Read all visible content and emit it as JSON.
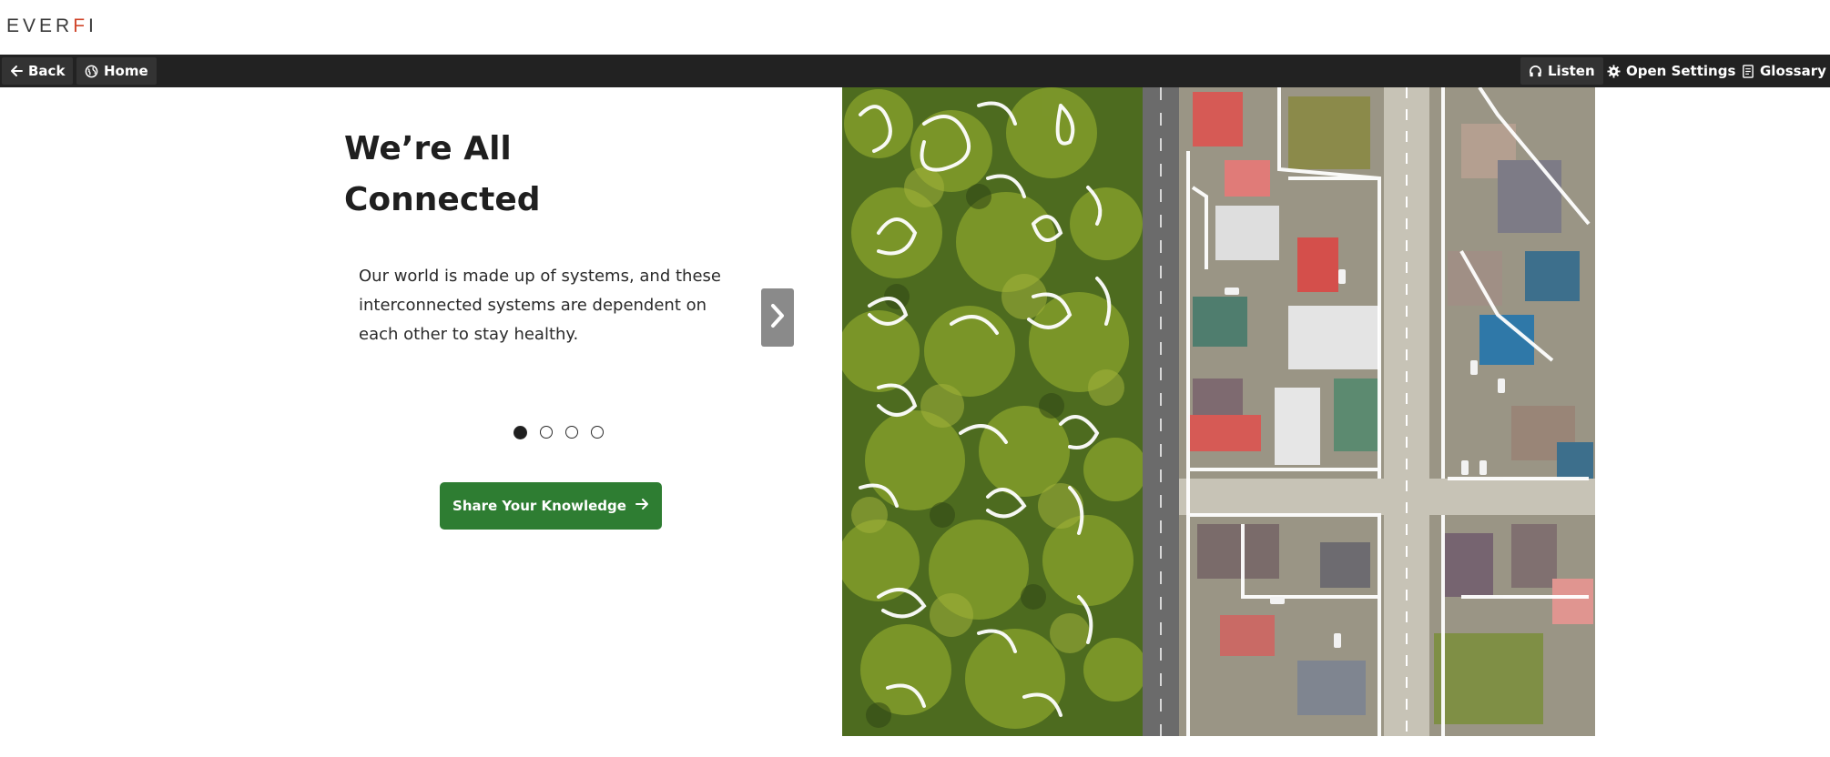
{
  "brand": {
    "logo_text_a": "EVER",
    "logo_text_b": "F",
    "logo_text_c": "I"
  },
  "toolbar": {
    "back_label": "Back",
    "home_label": "Home",
    "listen_label": "Listen",
    "settings_label": "Open Settings",
    "glossary_label": "Glossary"
  },
  "slide": {
    "title_line1": "We’re All",
    "title_line2": "Connected",
    "body_line1": "Our world is made up of systems, and these",
    "body_line2": "interconnected systems are dependent on",
    "body_line3": "each other to stay healthy.",
    "total_dots": 4,
    "active_dot": 1
  },
  "cta": {
    "label": "Share Your Knowledge"
  },
  "colors": {
    "toolbar_bg": "#222222",
    "cta_bg": "#2e7d32",
    "logo_accent": "#d0472c"
  }
}
